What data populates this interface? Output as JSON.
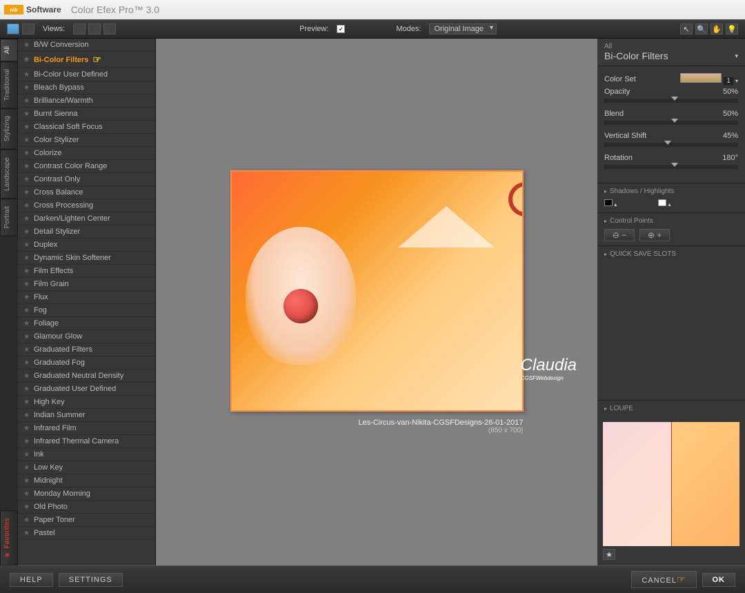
{
  "app": {
    "brand": "nik",
    "brand_suffix": "Software",
    "title": "Color Efex Pro™ 3.0"
  },
  "toolbar": {
    "views_label": "Views:",
    "preview_label": "Preview:",
    "preview_checked": "✓",
    "modes_label": "Modes:",
    "modes_value": "Original Image"
  },
  "vtabs": [
    "All",
    "Traditional",
    "Stylizing",
    "Landscape",
    "Portrait"
  ],
  "vtab_fav": "★ Favorites",
  "filters": [
    "B/W Conversion",
    "Bi-Color Filters",
    "Bi-Color User Defined",
    "Bleach Bypass",
    "Brilliance/Warmth",
    "Burnt Sienna",
    "Classical Soft Focus",
    "Color Stylizer",
    "Colorize",
    "Contrast Color Range",
    "Contrast Only",
    "Cross Balance",
    "Cross Processing",
    "Darken/Lighten Center",
    "Detail Stylizer",
    "Duplex",
    "Dynamic Skin Softener",
    "Film Effects",
    "Film Grain",
    "Flux",
    "Fog",
    "Foliage",
    "Glamour Glow",
    "Graduated Filters",
    "Graduated Fog",
    "Graduated Neutral Density",
    "Graduated User Defined",
    "High Key",
    "Indian Summer",
    "Infrared Film",
    "Infrared Thermal Camera",
    "Ink",
    "Low Key",
    "Midnight",
    "Monday Morning",
    "Old Photo",
    "Paper Toner",
    "Pastel"
  ],
  "selected_filter_index": 1,
  "preview": {
    "filename": "Les-Circus-van-Nikita-CGSFDesigns-26-01-2017",
    "dimensions": "(850 x 700)",
    "watermark": "Claudia",
    "watermark_sub": "CGSFWebdesign"
  },
  "right": {
    "head_sm": "All",
    "head_lg": "Bi-Color Filters",
    "controls": {
      "color_set": {
        "label": "Color Set",
        "value": "1"
      },
      "opacity": {
        "label": "Opacity",
        "value": "50%",
        "pos": 50
      },
      "blend": {
        "label": "Blend",
        "value": "50%",
        "pos": 50
      },
      "vertical_shift": {
        "label": "Vertical Shift",
        "value": "45%",
        "pos": 45
      },
      "rotation": {
        "label": "Rotation",
        "value": "180°",
        "pos": 50
      }
    },
    "shadows_highlights": "Shadows / Highlights",
    "control_points": "Control Points",
    "quick_save": "QUICK SAVE SLOTS",
    "loupe": "LOUPE"
  },
  "footer": {
    "help": "HELP",
    "settings": "SETTINGS",
    "cancel": "CANCEL",
    "ok": "OK"
  }
}
